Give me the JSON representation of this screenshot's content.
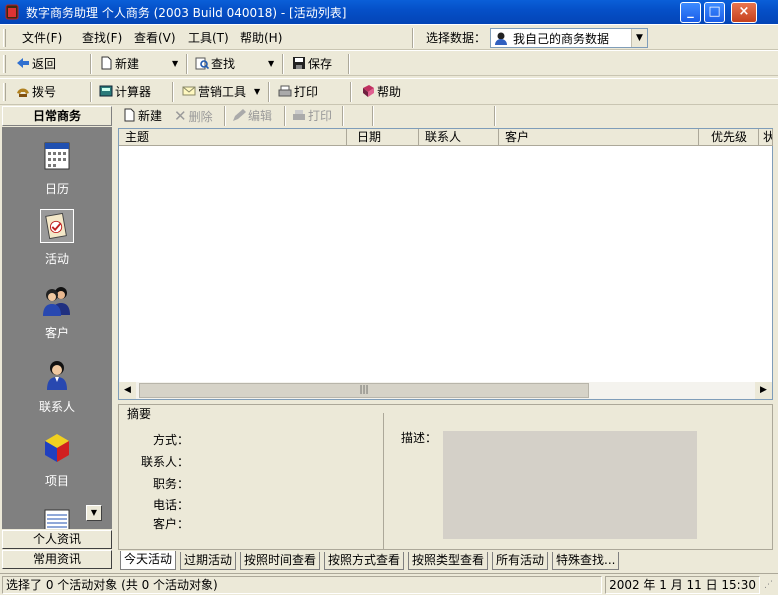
{
  "window": {
    "title": "数字商务助理 个人商务 (2003 Build 040018) - [活动列表]",
    "controls": {
      "minimize": "_",
      "maximize": "□",
      "close": "×"
    }
  },
  "menu": {
    "items": [
      "文件(F)",
      "查找(F)",
      "查看(V)",
      "工具(T)",
      "帮助(H)"
    ],
    "data_label": "选择数据：",
    "data_value": "我自己的商务数据"
  },
  "toolbar1": {
    "back": "返回",
    "new": "新建",
    "find": "查找",
    "save": "保存"
  },
  "toolbar2": {
    "dial": "拨号",
    "calculator": "计算器",
    "marketing": "营销工具",
    "print": "打印",
    "help": "帮助"
  },
  "listbar": {
    "new": "新建",
    "delete": "删除",
    "edit": "编辑",
    "print": "打印"
  },
  "sidebar": {
    "header": "日常商务",
    "items": [
      {
        "label": "日历",
        "icon": "calendar-icon"
      },
      {
        "label": "活动",
        "icon": "activity-icon"
      },
      {
        "label": "客户",
        "icon": "customers-icon"
      },
      {
        "label": "联系人",
        "icon": "contact-icon"
      },
      {
        "label": "项目",
        "icon": "project-icon"
      }
    ],
    "bottom": [
      "个人资讯",
      "常用资讯"
    ]
  },
  "table": {
    "columns": [
      "主题",
      "日期",
      "联系人",
      "客户",
      "优先级",
      "状"
    ],
    "rows": []
  },
  "summary": {
    "title": "摘要",
    "fields": [
      "方式：",
      "联系人：",
      "职务：",
      "电话：",
      "客户："
    ],
    "desc_label": "描述："
  },
  "tabs": [
    "今天活动",
    "过期活动",
    "按照时间查看",
    "按照方式查看",
    "按照类型查看",
    "所有活动",
    "特殊查找..."
  ],
  "status": {
    "left": "选择了 0 个活动对象 (共 0 个活动对象)",
    "date": "2002 年 1 月 11 日 15:30"
  },
  "colors": {
    "titlebar": "#0550c8",
    "sidebar_bg": "#808080",
    "desc_box": "#d4d0c8"
  }
}
